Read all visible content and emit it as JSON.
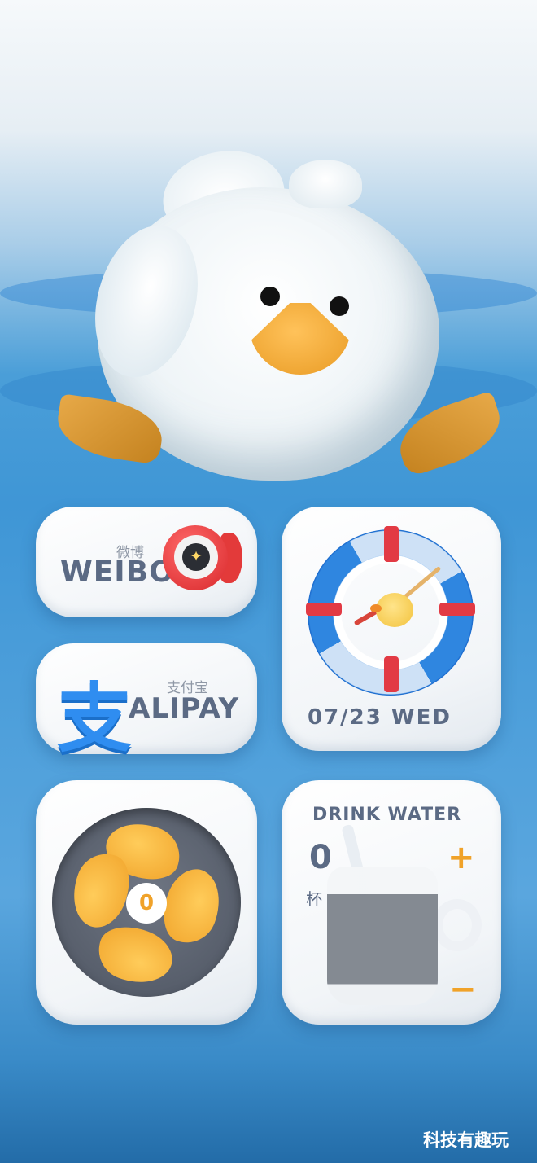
{
  "widgets": {
    "weibo": {
      "cn": "微博",
      "en": "WEIBO"
    },
    "alipay": {
      "cn": "支付宝",
      "en": "ALIPAY",
      "glyph": "支"
    },
    "clock": {
      "date": "07/23 WED"
    },
    "fan": {
      "value": "0"
    },
    "water": {
      "title": "DRINK WATER",
      "count": "0",
      "unit": "杯",
      "plus": "+",
      "minus": "−"
    }
  },
  "watermark": "科技有趣玩",
  "colors": {
    "accent_orange": "#f0a229",
    "weibo_red": "#d8282b",
    "alipay_blue": "#2f8df0",
    "ring_blue": "#2f86e0",
    "text_slate": "#5b6a84"
  }
}
